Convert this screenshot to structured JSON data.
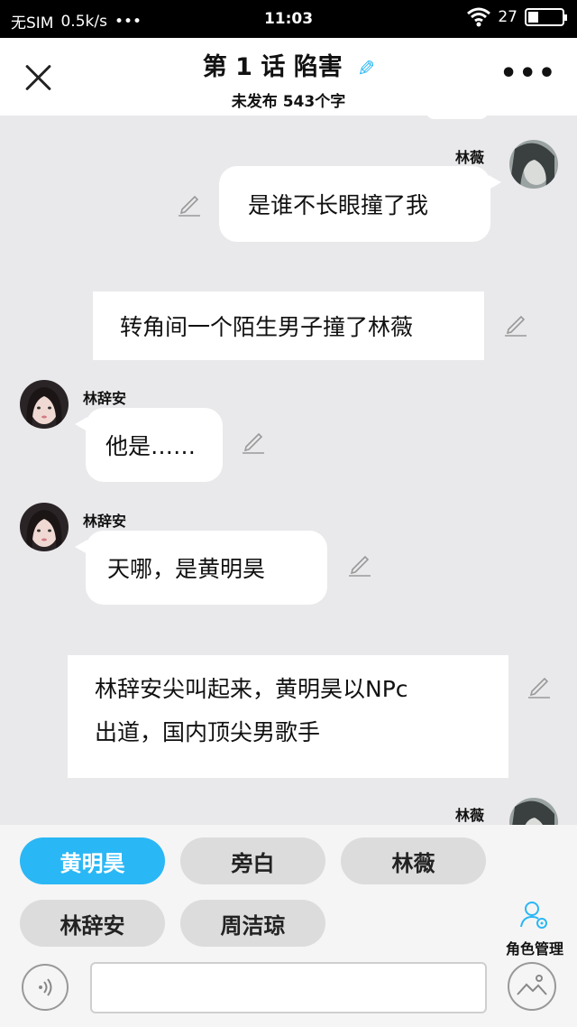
{
  "status_bar": {
    "carrier": "无SIM",
    "speed": "0.5k/s",
    "time": "11:03",
    "battery_percent": "27",
    "dots": "•••"
  },
  "header": {
    "title": "第 1 话 陷害",
    "subtitle": "未发布 543个字",
    "more": "•••"
  },
  "messages": [
    {
      "type": "right",
      "speaker": "林薇",
      "text": "是谁不长眼撞了我"
    },
    {
      "type": "narration",
      "text": "转角间一个陌生男子撞了林薇"
    },
    {
      "type": "left",
      "speaker": "林辞安",
      "text": "他是……"
    },
    {
      "type": "left",
      "speaker": "林辞安",
      "text": "天哪，是黄明昊"
    },
    {
      "type": "narration",
      "text_line1": "林辞安尖叫起来，黄明昊以NPc",
      "text_line2": "出道，国内顶尖男歌手"
    },
    {
      "type": "right",
      "speaker": "林薇"
    }
  ],
  "roles": [
    {
      "label": "黄明昊",
      "active": true
    },
    {
      "label": "旁白",
      "active": false
    },
    {
      "label": "林薇",
      "active": false
    },
    {
      "label": "林辞安",
      "active": false
    },
    {
      "label": "周洁琼",
      "active": false
    }
  ],
  "role_manage_label": "角色管理",
  "input": {
    "value": ""
  },
  "colors": {
    "accent": "#2ab7f5",
    "background": "#e9e9ec",
    "bubble": "#ffffff"
  },
  "icons": [
    "close-icon",
    "edit-icon",
    "more-icon",
    "voice-icon",
    "image-icon",
    "role-manage-icon"
  ]
}
